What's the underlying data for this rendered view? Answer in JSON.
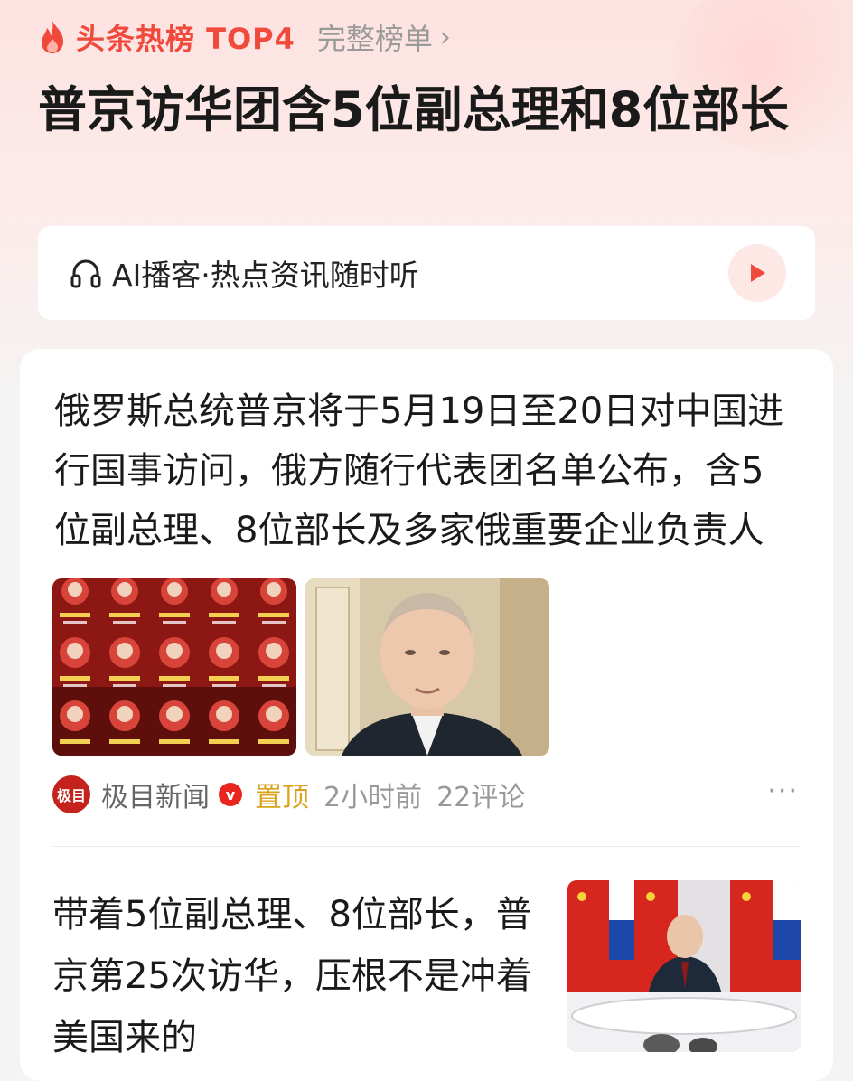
{
  "header": {
    "hot_title": "头条热榜 TOP4",
    "full_list_label": "完整榜单",
    "headline": "普京访华团含5位副总理和8位部长"
  },
  "podcast": {
    "label": "AI播客·热点资讯随时听"
  },
  "articles": [
    {
      "text": "俄罗斯总统普京将于5月19日至20日对中国进行国事访问，俄方随行代表团名单公布，含5位副总理、8位部长及多家俄重要企业负责人",
      "source": "极目新闻",
      "source_logo_text": "极目",
      "pin_label": "置顶",
      "time": "2小时前",
      "comments": "22评论"
    },
    {
      "text": "带着5位副总理、8位部长，普京第25次访华，压根不是冲着美国来的"
    }
  ],
  "colors": {
    "accent": "#f04a3c",
    "pin": "#d9a21c",
    "muted": "#999999"
  },
  "icons": {
    "hot": "flame-icon",
    "chevron": "chevron-right-icon",
    "podcast": "headphones-icon",
    "play": "play-icon",
    "verified": "verified-badge-icon",
    "more": "more-icon"
  }
}
